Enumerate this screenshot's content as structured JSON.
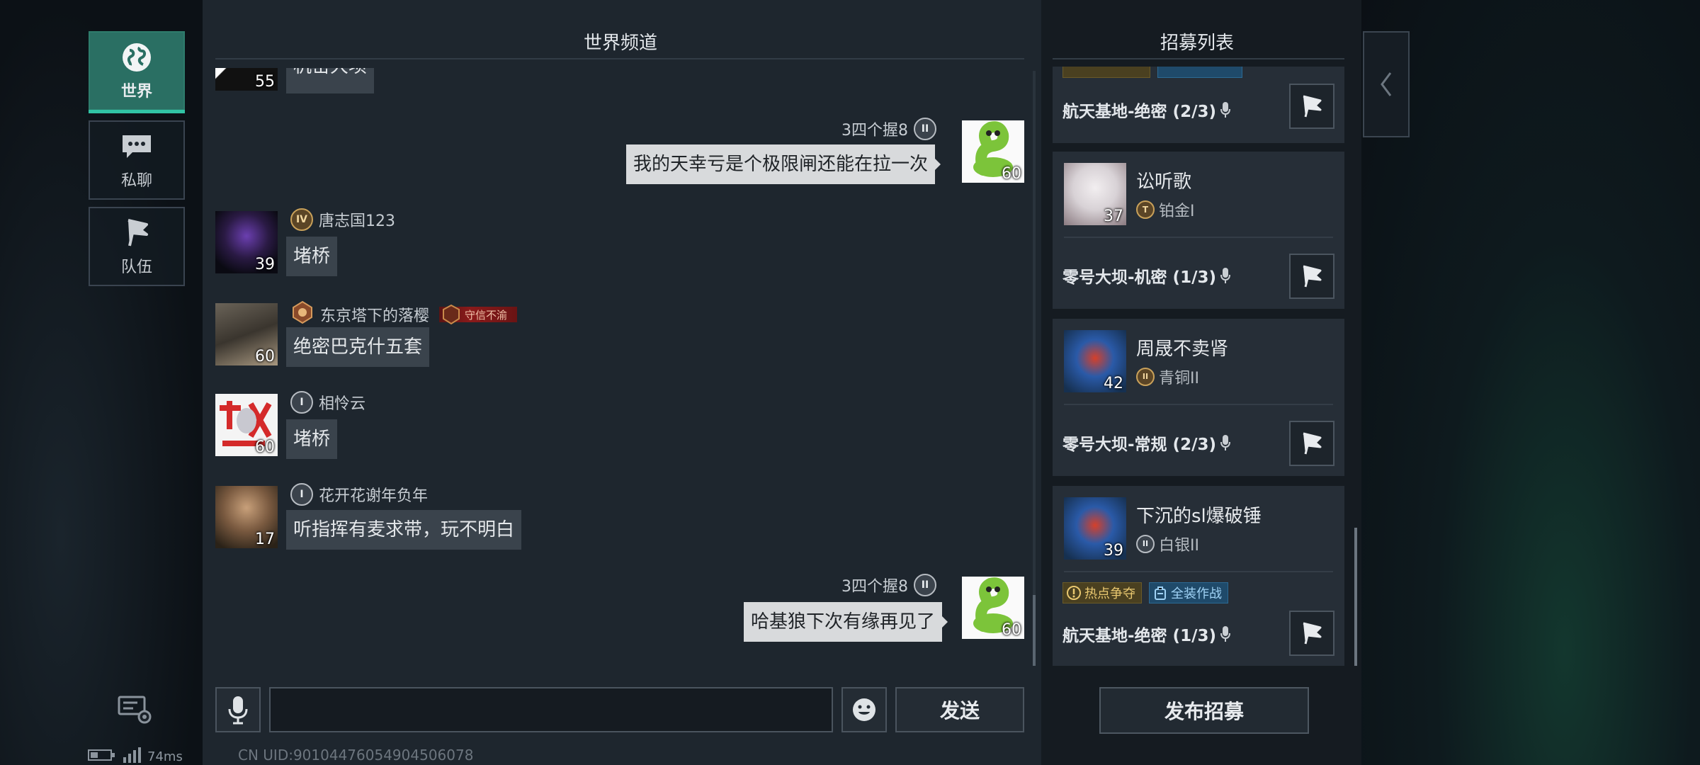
{
  "nav": {
    "world": "世界",
    "private": "私聊",
    "team": "队伍"
  },
  "status": {
    "ping": "74ms"
  },
  "chat": {
    "title": "世界频道",
    "messages": [
      {
        "level": "55",
        "text": "机密大坝"
      },
      {
        "name": "3四个握8",
        "rank": "II",
        "level": "60",
        "text": "我的天幸亏是个极限闸还能在拉一次"
      },
      {
        "name": "唐志国123",
        "rank": "IV",
        "level": "39",
        "text": "堵桥"
      },
      {
        "name": "东京塔下的落樱",
        "title_tag": "守信不渝",
        "level": "60",
        "text": "绝密巴克什五套"
      },
      {
        "name": "相怜云",
        "rank": "I",
        "level": "60",
        "text": "堵桥"
      },
      {
        "name": "花开花谢年负年",
        "rank": "I",
        "level": "17",
        "text": "听指挥有麦求带，玩不明白"
      },
      {
        "name": "3四个握8",
        "rank": "II",
        "level": "60",
        "text": "哈基狼下次有缘再见了"
      }
    ],
    "input_placeholder": "",
    "send": "发送",
    "uid": "CN UID:9010447605490450​6078"
  },
  "recruit": {
    "title": "招募列表",
    "cards": [
      {
        "mode": "航天基地-绝密 (2/3)"
      },
      {
        "name": "讼听歌",
        "rank": "铂金I",
        "level": "37",
        "mode": "零号大坝-机密 (1/3)"
      },
      {
        "name": "周晟不卖肾",
        "rank": "青铜II",
        "level": "42",
        "mode": "零号大坝-常规 (2/3)"
      },
      {
        "name": "下沉的sl爆破锤",
        "rank": "白银II",
        "level": "39",
        "tag_hot": "热点争夺",
        "tag_gear": "全装作战",
        "mode": "航天基地-绝密 (1/3)"
      }
    ],
    "publish": "发布招募"
  },
  "colors": {
    "accent": "#2a6f63",
    "accent_bar": "#31c3a4",
    "panel": "#1e262e",
    "hot_tag": "#e9c870",
    "gear_tag": "#9fd2f5"
  }
}
